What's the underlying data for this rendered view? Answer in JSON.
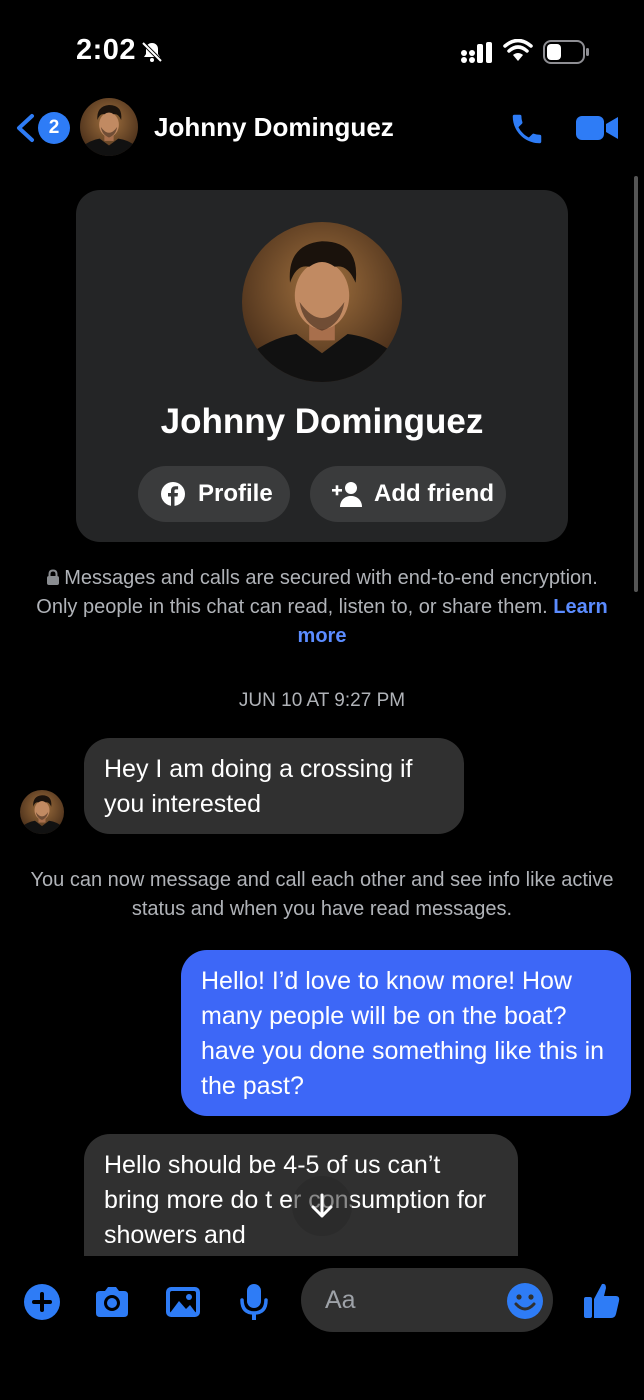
{
  "status_bar": {
    "time": "2:02",
    "icons": [
      "bell-slash-icon",
      "signal-icon",
      "wifi-icon",
      "battery-icon"
    ]
  },
  "header": {
    "back_badge_count": "2",
    "contact_name": "Johnny Dominguez",
    "actions": [
      "phone-icon",
      "video-camera-icon"
    ]
  },
  "profile_card": {
    "name": "Johnny Dominguez",
    "profile_button": "Profile",
    "add_friend_button": "Add friend"
  },
  "encryption_notice": {
    "text": "Messages and calls are secured with end-to-end encryption. Only people in this chat can read, listen to, or share them.",
    "link": "Learn more"
  },
  "conversation": {
    "timestamp": "JUN 10 AT 9:27 PM",
    "messages": [
      {
        "direction": "incoming",
        "text": "Hey I am doing a crossing if you interested"
      },
      {
        "direction": "outgoing",
        "text": "Hello! I’d love to know more! How many people will be on the boat? have you done something like this in the past?"
      },
      {
        "direction": "incoming",
        "text": "Hello should be 4-5 of us can’t bring more do t   er consumption for showers and"
      }
    ],
    "system_notice": "You can now message and call each other and see info like active status and when you have read messages."
  },
  "composer": {
    "placeholder": "Aa",
    "icons": [
      "plus-icon",
      "camera-icon",
      "image-icon",
      "microphone-icon",
      "emoji-icon",
      "thumbs-up-icon"
    ]
  },
  "colors": {
    "accent": "#2e7cf6",
    "outgoing_bubble": "#3d67f7",
    "incoming_bubble": "#303030",
    "card_bg": "#242526",
    "secondary_text": "#b0b3b8",
    "link": "#5b8cff"
  }
}
